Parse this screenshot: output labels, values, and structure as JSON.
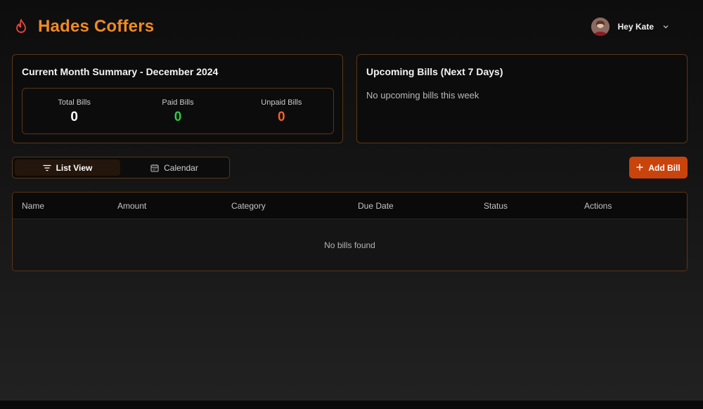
{
  "app": {
    "title": "Hades Coffers",
    "brand_color": "#f08a24",
    "icon": "flame-icon"
  },
  "user": {
    "greeting": "Hey Kate",
    "avatar_icon": "avatar-photo"
  },
  "summary": {
    "title": "Current Month Summary - December 2024",
    "stats": [
      {
        "label": "Total Bills",
        "value": "0",
        "color": "#ffffff"
      },
      {
        "label": "Paid Bills",
        "value": "0",
        "color": "#2ecc40"
      },
      {
        "label": "Unpaid Bills",
        "value": "0",
        "color": "#f0622a"
      }
    ]
  },
  "upcoming": {
    "title": "Upcoming Bills (Next 7 Days)",
    "empty_text": "No upcoming bills this week"
  },
  "view_toggle": {
    "tabs": [
      {
        "label": "List View",
        "icon": "filter-lines-icon",
        "active": true
      },
      {
        "label": "Calendar",
        "icon": "calendar-icon",
        "active": false
      }
    ]
  },
  "actions": {
    "add_bill_label": "Add Bill",
    "add_bill_color": "#c9440c"
  },
  "table": {
    "columns": [
      "Name",
      "Amount",
      "Category",
      "Due Date",
      "Status",
      "Actions"
    ],
    "rows": [],
    "empty_text": "No bills found"
  }
}
